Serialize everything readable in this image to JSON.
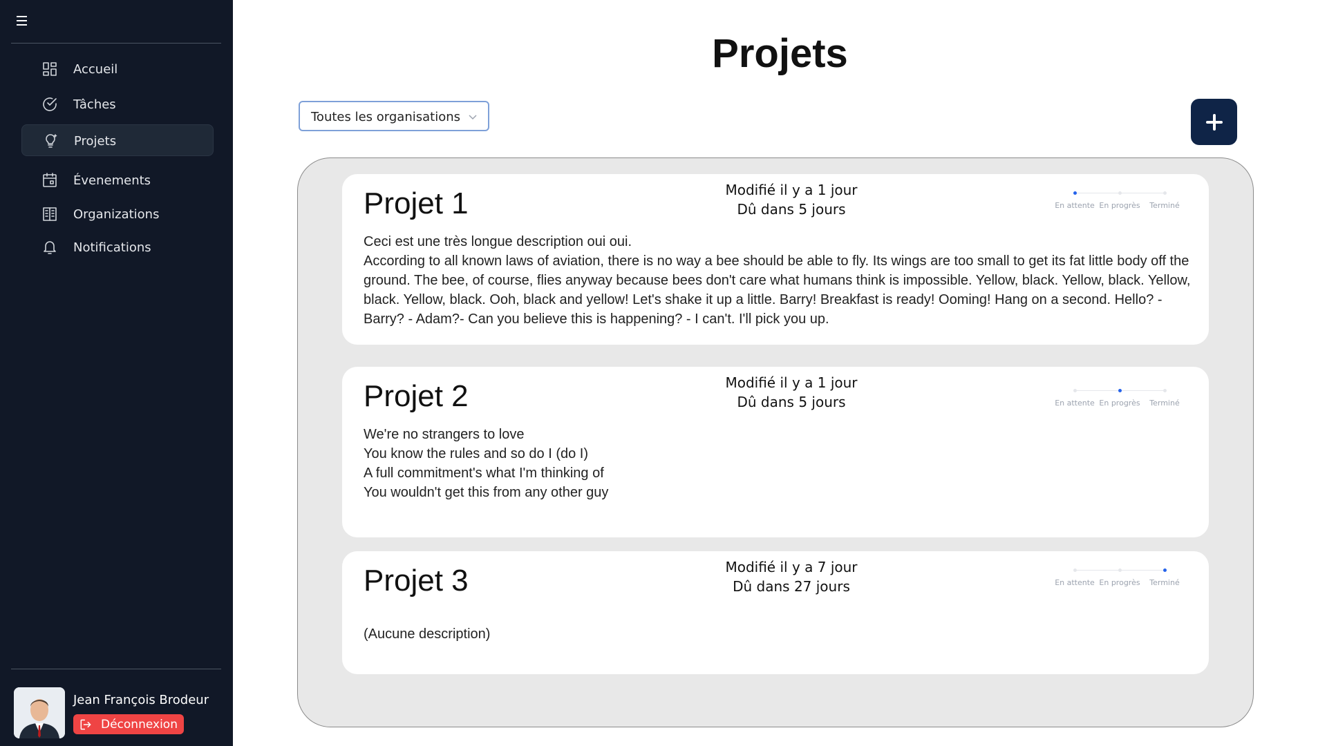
{
  "sidebar": {
    "menu_icon": "hamburger-icon",
    "items": [
      {
        "label": "Accueil",
        "icon": "dashboard-icon"
      },
      {
        "label": "Tâches",
        "icon": "check-circle-icon"
      },
      {
        "label": "Projets",
        "icon": "lightbulb-icon"
      },
      {
        "label": "Évenements",
        "icon": "calendar-icon"
      },
      {
        "label": "Organizations",
        "icon": "building-icon"
      },
      {
        "label": "Notifications",
        "icon": "bell-icon"
      }
    ],
    "active_item": "Projets",
    "user": {
      "name": "Jean François Brodeur",
      "logout_label": "Déconnexion"
    }
  },
  "main": {
    "title": "Projets",
    "org_filter": {
      "selected": "Toutes les organisations"
    },
    "add_button_icon": "plus-icon",
    "status_labels": [
      "En attente",
      "En progrès",
      "Terminé"
    ],
    "projects": [
      {
        "title": "Projet 1",
        "modified": "Modifié il y a 1 jour",
        "due": "Dû dans 5 jours",
        "status_index": 0,
        "description": "Ceci est une très longue description oui oui.\nAccording to all known laws of aviation, there is no way a bee should be able to fly. Its wings are too small to get its fat little body off the ground. The bee, of course, flies anyway because bees don't care what humans think is impossible. Yellow, black. Yellow, black. Yellow, black. Yellow, black. Ooh, black and yellow! Let's shake it up a little. Barry! Breakfast is ready! Ooming! Hang on a second. Hello? - Barry? - Adam?- Can you believe this is happening? - I can't. I'll pick you up."
      },
      {
        "title": "Projet 2",
        "modified": "Modifié il y a 1 jour",
        "due": "Dû dans 5 jours",
        "status_index": 1,
        "description": "We're no strangers to love\nYou know the rules and so do I (do I)\nA full commitment's what I'm thinking of\nYou wouldn't get this from any other guy"
      },
      {
        "title": "Projet 3",
        "modified": "Modifié il y a 7 jour",
        "due": "Dû dans 27 jours",
        "status_index": 2,
        "description": "(Aucune description)"
      }
    ]
  },
  "colors": {
    "sidebar_bg": "#111827",
    "accent_blue": "#2563eb",
    "add_button": "#0f2447",
    "logout_red": "#ef4444",
    "panel_bg": "#e8e8e8"
  }
}
